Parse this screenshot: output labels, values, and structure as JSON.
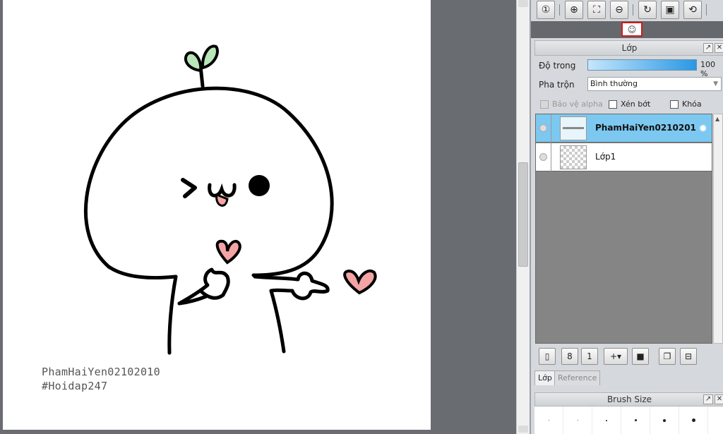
{
  "canvas": {
    "caption_line1": "PhamHaiYen02102010",
    "caption_line2": "#Hoidap247"
  },
  "navigator_toolbar": {
    "buttons": [
      "zoom-actual-icon",
      "zoom-in-icon",
      "fit-window-icon",
      "zoom-out-icon",
      "rotate-icon",
      "fullscreen-icon",
      "flip-icon"
    ]
  },
  "layer_panel": {
    "title": "Lớp",
    "opacity_label": "Độ trong",
    "opacity_value": "100 %",
    "opacity_percent": 100,
    "blend_label": "Pha trộn",
    "blend_value": "Bình thường",
    "protect_alpha_label": "Bảo vệ alpha",
    "clipping_label": "Xén bớt",
    "lock_label": "Khóa",
    "layers": [
      {
        "name": "PhamHaiYen0210201",
        "selected": true
      },
      {
        "name": "Lớp1",
        "selected": false
      }
    ],
    "tabs": [
      "Lớp",
      "Reference"
    ]
  },
  "brush_panel": {
    "title": "Brush Size"
  },
  "colors": {
    "selected_layer": "#7cc8f0",
    "opacity_fill": "#2a98e4",
    "preview_border": "#d21a1a"
  }
}
